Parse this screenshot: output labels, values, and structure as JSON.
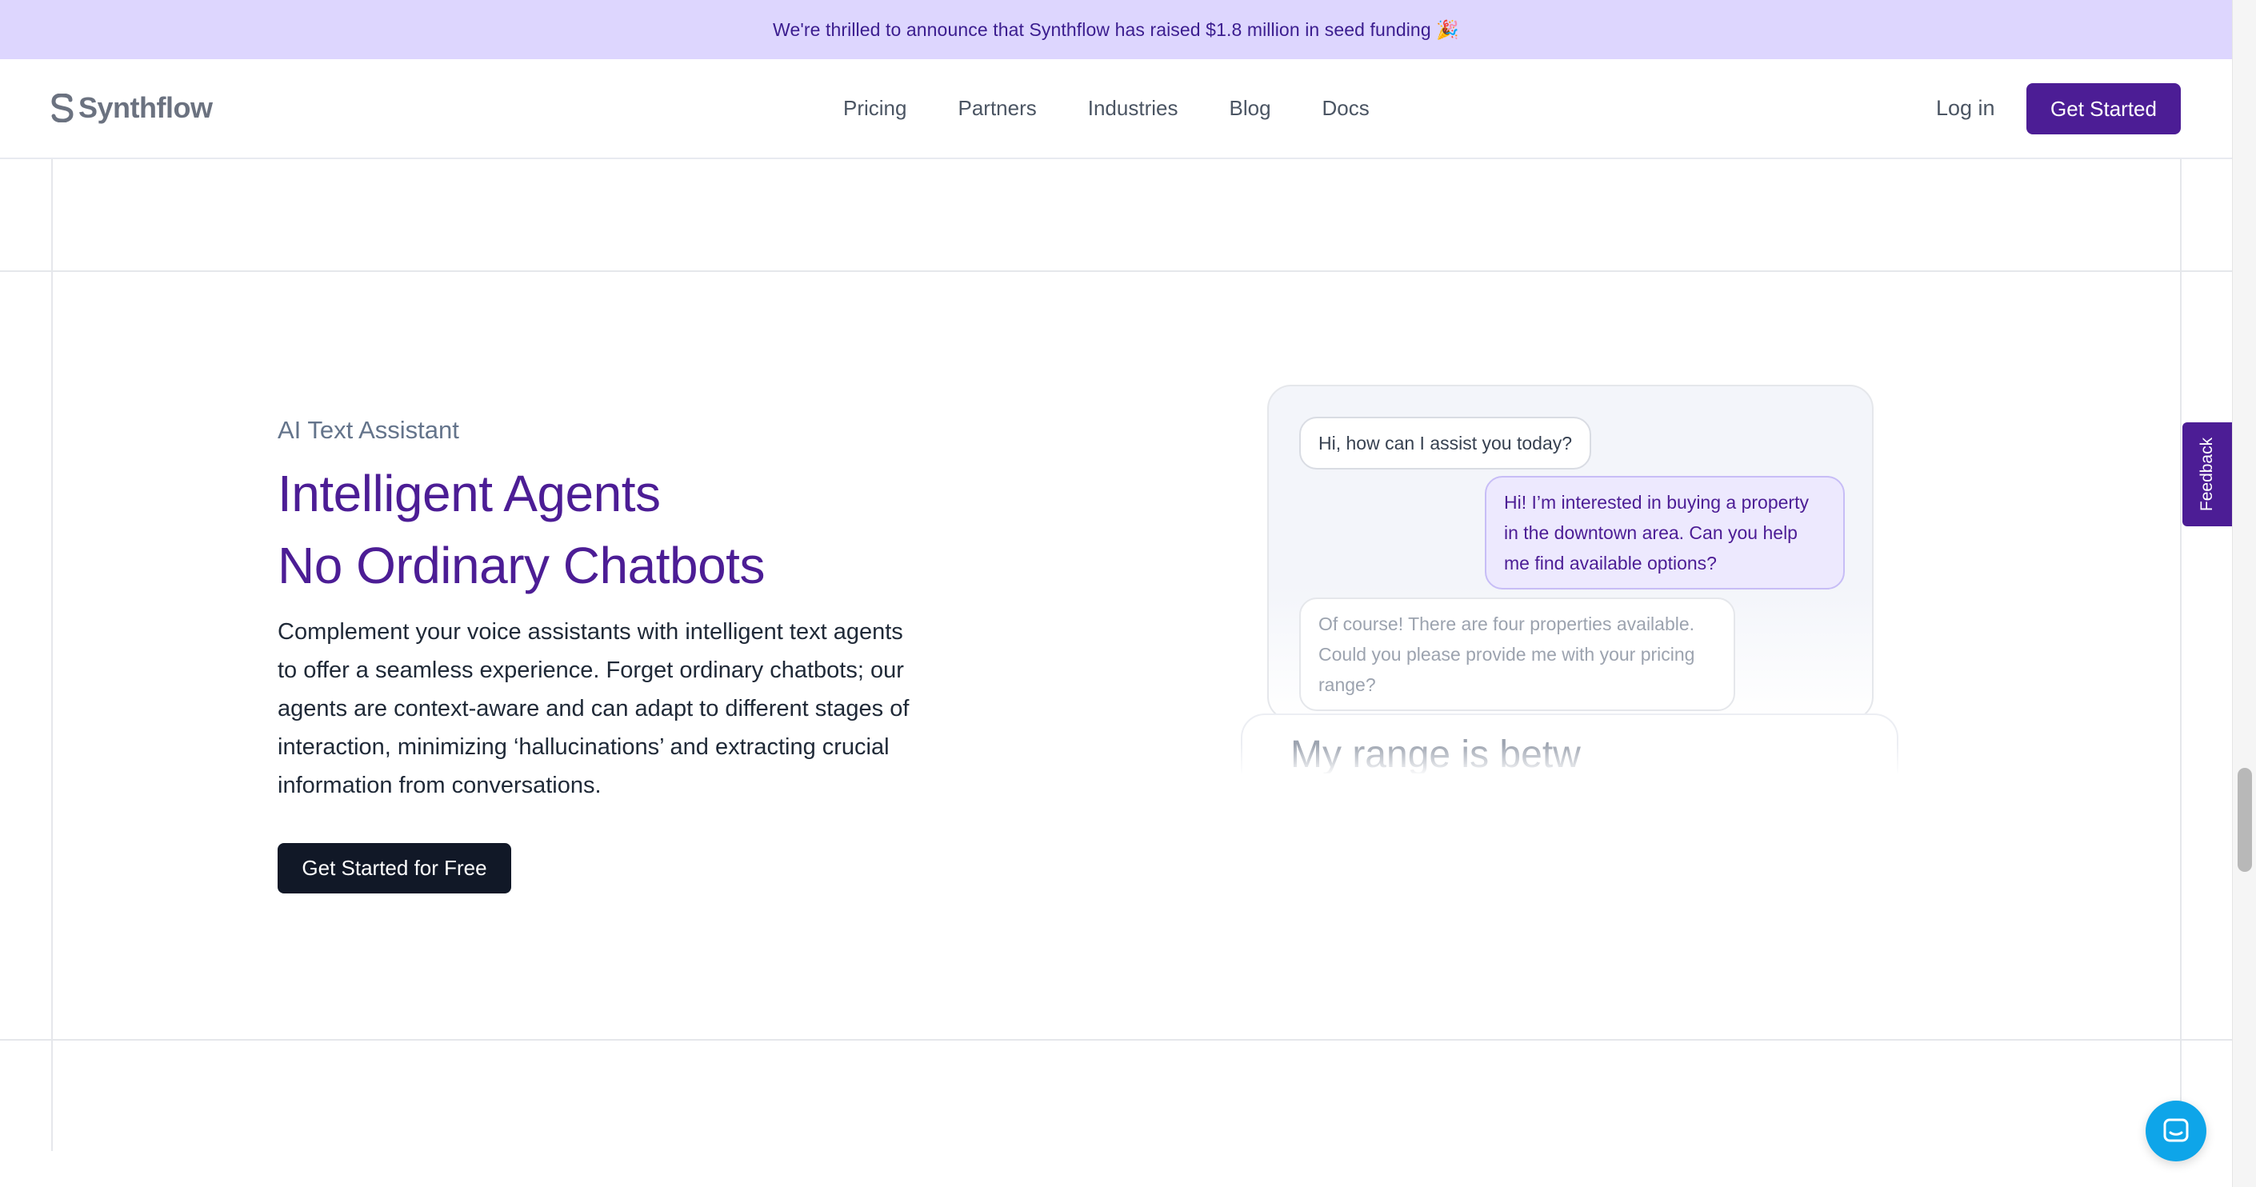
{
  "announcement": {
    "text": "We're thrilled to announce that Synthflow has raised $1.8 million in seed funding 🎉"
  },
  "brand": {
    "name": "Synthflow",
    "accent": "#4c1d95",
    "announce_bg": "#ddd6fe"
  },
  "nav": {
    "links": [
      "Pricing",
      "Partners",
      "Industries",
      "Blog",
      "Docs"
    ],
    "login_label": "Log in",
    "cta_label": "Get Started"
  },
  "hero": {
    "eyebrow": "AI Text Assistant",
    "headline_line1": "Intelligent Agents",
    "headline_line2": "No Ordinary Chatbots",
    "body": "Complement your voice assistants with intelligent text agents to offer a seamless experience. Forget ordinary chatbots; our agents are context-aware and can adapt to different stages of interaction, minimizing ‘hallucinations’ and extracting crucial information from conversations.",
    "cta_label": "Get Started for Free"
  },
  "chat": {
    "messages": [
      {
        "from": "agent",
        "text": "Hi, how can I assist you today?"
      },
      {
        "from": "user",
        "text": "Hi! I’m interested in buying a property in the downtown area. Can you help me find available options?"
      },
      {
        "from": "agent",
        "text": "Of course! There are four properties available. Could you please provide me with your pricing range?"
      }
    ],
    "input_text": "My range is betw"
  },
  "feedback": {
    "label": "Feedback"
  },
  "icons": {
    "launcher": "chat-bubble-icon",
    "logo": "synthflow-s-logo-icon"
  }
}
